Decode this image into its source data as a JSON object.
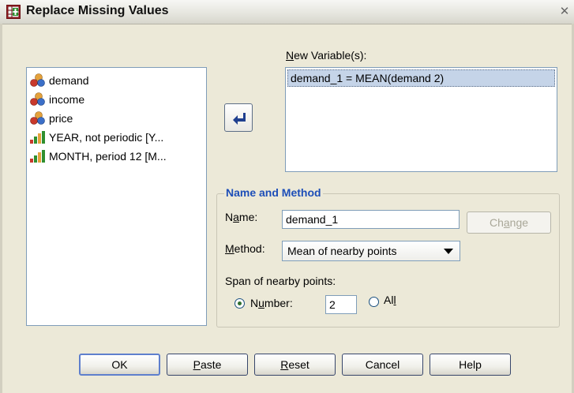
{
  "window": {
    "title": "Replace Missing Values",
    "app_icon": "spss-replace-icon",
    "close": "close-icon"
  },
  "source_list": {
    "items": [
      {
        "label": "demand",
        "icon": "scale-variable-icon"
      },
      {
        "label": "income",
        "icon": "scale-variable-icon"
      },
      {
        "label": "price",
        "icon": "scale-variable-icon"
      },
      {
        "label": "YEAR, not periodic [Y...",
        "icon": "ordinal-variable-icon"
      },
      {
        "label": "MONTH, period 12 [M...",
        "icon": "ordinal-variable-icon"
      }
    ]
  },
  "new_variables": {
    "label_pre": "",
    "label_u": "N",
    "label_post": "ew Variable(s):",
    "items": [
      "demand_1 = MEAN(demand 2)"
    ]
  },
  "name_method": {
    "title": "Name and Method",
    "name_label_pre": "N",
    "name_label_u": "a",
    "name_label_post": "me:",
    "name_value": "demand_1",
    "change_pre": "Ch",
    "change_u": "a",
    "change_post": "nge",
    "method_label_u": "M",
    "method_label_post": "ethod:",
    "method_value": "Mean of nearby points",
    "span_label": "Span of nearby points:",
    "number_pre": "N",
    "number_u": "u",
    "number_post": "mber:",
    "number_value": "2",
    "all_pre": "Al",
    "all_u": "l",
    "span_selected": "number"
  },
  "buttons": {
    "ok": "OK",
    "paste_u": "P",
    "paste_post": "aste",
    "reset_u": "R",
    "reset_post": "eset",
    "cancel": "Cancel",
    "help": "Help"
  },
  "colors": {
    "accent": "#1d4eb8",
    "selection": "#c5d4e8",
    "dialog_bg": "#ece9d8"
  }
}
